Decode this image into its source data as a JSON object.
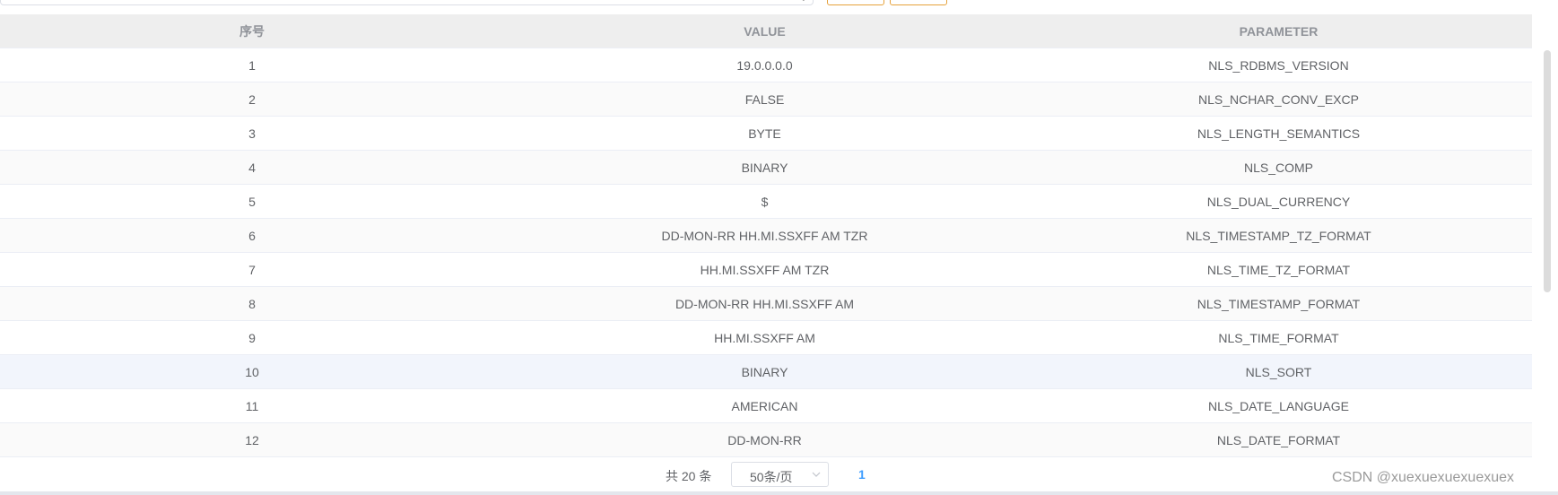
{
  "table": {
    "headers": [
      "序号",
      "VALUE",
      "PARAMETER"
    ],
    "rows": [
      {
        "index": "1",
        "value": "19.0.0.0.0",
        "parameter": "NLS_RDBMS_VERSION"
      },
      {
        "index": "2",
        "value": "FALSE",
        "parameter": "NLS_NCHAR_CONV_EXCP"
      },
      {
        "index": "3",
        "value": "BYTE",
        "parameter": "NLS_LENGTH_SEMANTICS"
      },
      {
        "index": "4",
        "value": "BINARY",
        "parameter": "NLS_COMP"
      },
      {
        "index": "5",
        "value": "$",
        "parameter": "NLS_DUAL_CURRENCY"
      },
      {
        "index": "6",
        "value": "DD-MON-RR HH.MI.SSXFF AM TZR",
        "parameter": "NLS_TIMESTAMP_TZ_FORMAT"
      },
      {
        "index": "7",
        "value": "HH.MI.SSXFF AM TZR",
        "parameter": "NLS_TIME_TZ_FORMAT"
      },
      {
        "index": "8",
        "value": "DD-MON-RR HH.MI.SSXFF AM",
        "parameter": "NLS_TIMESTAMP_FORMAT"
      },
      {
        "index": "9",
        "value": "HH.MI.SSXFF AM",
        "parameter": "NLS_TIME_FORMAT"
      },
      {
        "index": "10",
        "value": "BINARY",
        "parameter": "NLS_SORT"
      },
      {
        "index": "11",
        "value": "AMERICAN",
        "parameter": "NLS_DATE_LANGUAGE"
      },
      {
        "index": "12",
        "value": "DD-MON-RR",
        "parameter": "NLS_DATE_FORMAT"
      }
    ]
  },
  "pagination": {
    "total": "共 20 条",
    "page_size": "50条/页",
    "current_page": "1"
  },
  "watermark": "CSDN @xuexuexuexuexuex",
  "colors": {
    "header_bg": "#eeeeee",
    "stripe_bg": "#fafafa",
    "hover_bg": "#f2f5fc",
    "accent": "#409eff",
    "button_border": "#e6a23c"
  }
}
